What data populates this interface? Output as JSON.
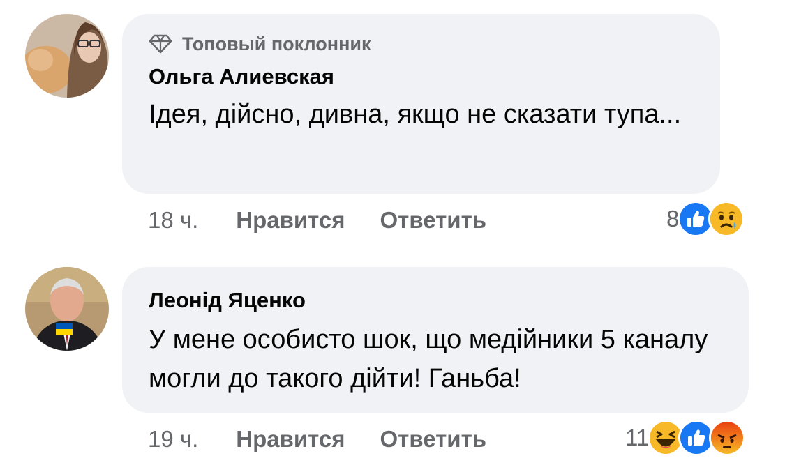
{
  "comments": [
    {
      "badge": "Топовый поклонник",
      "author": "Ольга Алиевская",
      "text": "Ідея, дійсно, дивна, якщо не сказати тупа...",
      "time": "18 ч.",
      "like_label": "Нравится",
      "reply_label": "Ответить",
      "reaction_count": "8",
      "reactions": [
        "like-icon",
        "sad-icon"
      ]
    },
    {
      "author": "Леонід Яценко",
      "text": "У мене особисто шок, що медійники 5 каналу могли до такого дійти! Ганьба!",
      "time": "19 ч.",
      "like_label": "Нравится",
      "reply_label": "Ответить",
      "reaction_count": "11",
      "reactions": [
        "haha-icon",
        "like-icon",
        "angry-icon"
      ]
    }
  ],
  "colors": {
    "bubble": "#f0f2f5",
    "secondary_text": "#65676b",
    "like_blue": "#1877f2",
    "emoji_yellow": "#f7b928",
    "angry_orange": "#e9710f"
  }
}
